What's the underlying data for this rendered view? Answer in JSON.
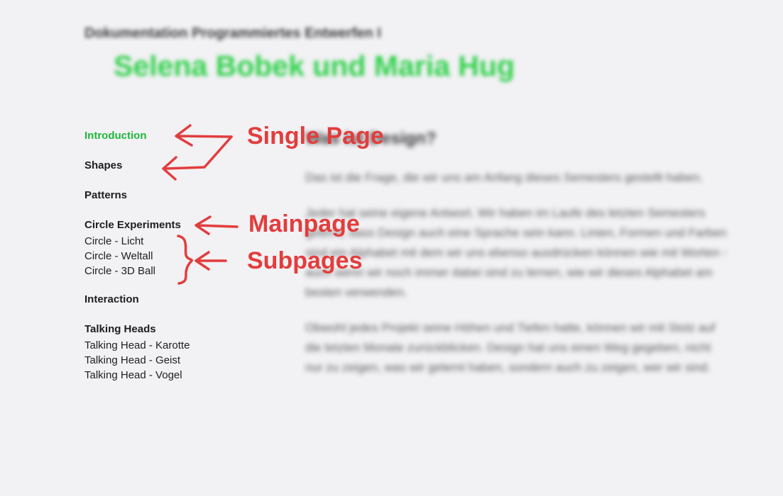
{
  "header": {
    "subtitle": "Dokumentation Programmiertes Entwerfen I",
    "title": "Selena Bobek und Maria Hug"
  },
  "nav": {
    "groups": [
      {
        "label": "Introduction",
        "active": true,
        "subs": []
      },
      {
        "label": "Shapes",
        "subs": []
      },
      {
        "label": "Patterns",
        "subs": []
      },
      {
        "label": "Circle Experiments",
        "subs": [
          "Circle - Licht",
          "Circle - Weltall",
          "Circle - 3D Ball"
        ]
      },
      {
        "label": "Interaction",
        "subs": []
      },
      {
        "label": "Talking Heads",
        "subs": [
          "Talking Head - Karotte",
          "Talking Head - Geist",
          "Talking Head - Vogel"
        ]
      }
    ]
  },
  "content": {
    "heading": "Was ist Design?",
    "paragraphs": [
      "Das ist die Frage, die wir uns am Anfang dieses Semesters gestellt haben.",
      "Jeder hat seine eigene Antwort. Wir haben im Laufe des letzten Semesters gelernt, dass Design auch eine Sprache sein kann. Linien, Formen und Farben sind ein Alphabet mit dem wir uns ebenso ausdrücken können wie mit Worten - auch wenn wir noch immer dabei sind zu lernen, wie wir dieses Alphabet am besten verwenden.",
      "Obwohl jedes Projekt seine Höhen und Tiefen hatte, können wir mit Stolz auf die letzten Monate zurückblicken. Design hat uns einen Weg gegeben, nicht nur zu zeigen, was wir gelernt haben, sondern auch zu zeigen, wer wir sind."
    ]
  },
  "annotations": {
    "single_page": "Single Page",
    "mainpage": "Mainpage",
    "subpages": "Subpages",
    "color": "#e23d3d"
  },
  "colors": {
    "background": "#f2f1f4",
    "title_green": "#2fd14a",
    "active_nav": "#1fb83a"
  }
}
